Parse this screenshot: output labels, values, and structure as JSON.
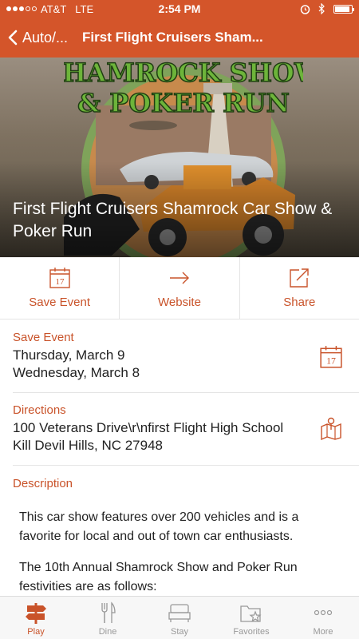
{
  "status": {
    "carrier": "AT&T",
    "network": "LTE",
    "time": "2:54 PM",
    "alarm_icon": "alarm-icon",
    "bluetooth_icon": "bluetooth-icon",
    "battery_level": 0.9
  },
  "nav": {
    "back_label": "Auto/...",
    "title": "First Flight Cruisers Sham..."
  },
  "hero": {
    "title": "First Flight Cruisers Shamrock Car Show & Poker Run",
    "logo_text_1": "SHAMROCK SHOW",
    "logo_text_2": "& POKER RUN"
  },
  "actions": [
    {
      "label": "Save Event",
      "icon": "calendar-icon",
      "day": "17"
    },
    {
      "label": "Website",
      "icon": "arrow-right-icon"
    },
    {
      "label": "Share",
      "icon": "share-icon"
    }
  ],
  "save_event": {
    "label": "Save Event",
    "lines": [
      "Thursday, March 9",
      "Wednesday, March 8"
    ],
    "icon_day": "17"
  },
  "directions": {
    "label": "Directions",
    "lines": [
      "100 Veterans Drive\\r\\nfirst Flight High School",
      "Kill Devil Hills, NC 27948"
    ]
  },
  "description": {
    "label": "Description",
    "paragraphs": [
      "This car show features over 200 vehicles and is a favorite for local and out of town car enthusiasts.",
      "The 10th Annual Shamrock Show and Poker Run festivities are as follows:"
    ]
  },
  "tabs": [
    {
      "label": "Play",
      "icon": "signpost-icon",
      "active": true
    },
    {
      "label": "Dine",
      "icon": "fork-knife-icon",
      "active": false
    },
    {
      "label": "Stay",
      "icon": "bed-icon",
      "active": false
    },
    {
      "label": "Favorites",
      "icon": "folder-star-icon",
      "active": false
    },
    {
      "label": "More",
      "icon": "more-icon",
      "active": false
    }
  ],
  "colors": {
    "brand": "#d4552a",
    "accent_text": "#c9532a",
    "tab_inactive": "#999999"
  }
}
